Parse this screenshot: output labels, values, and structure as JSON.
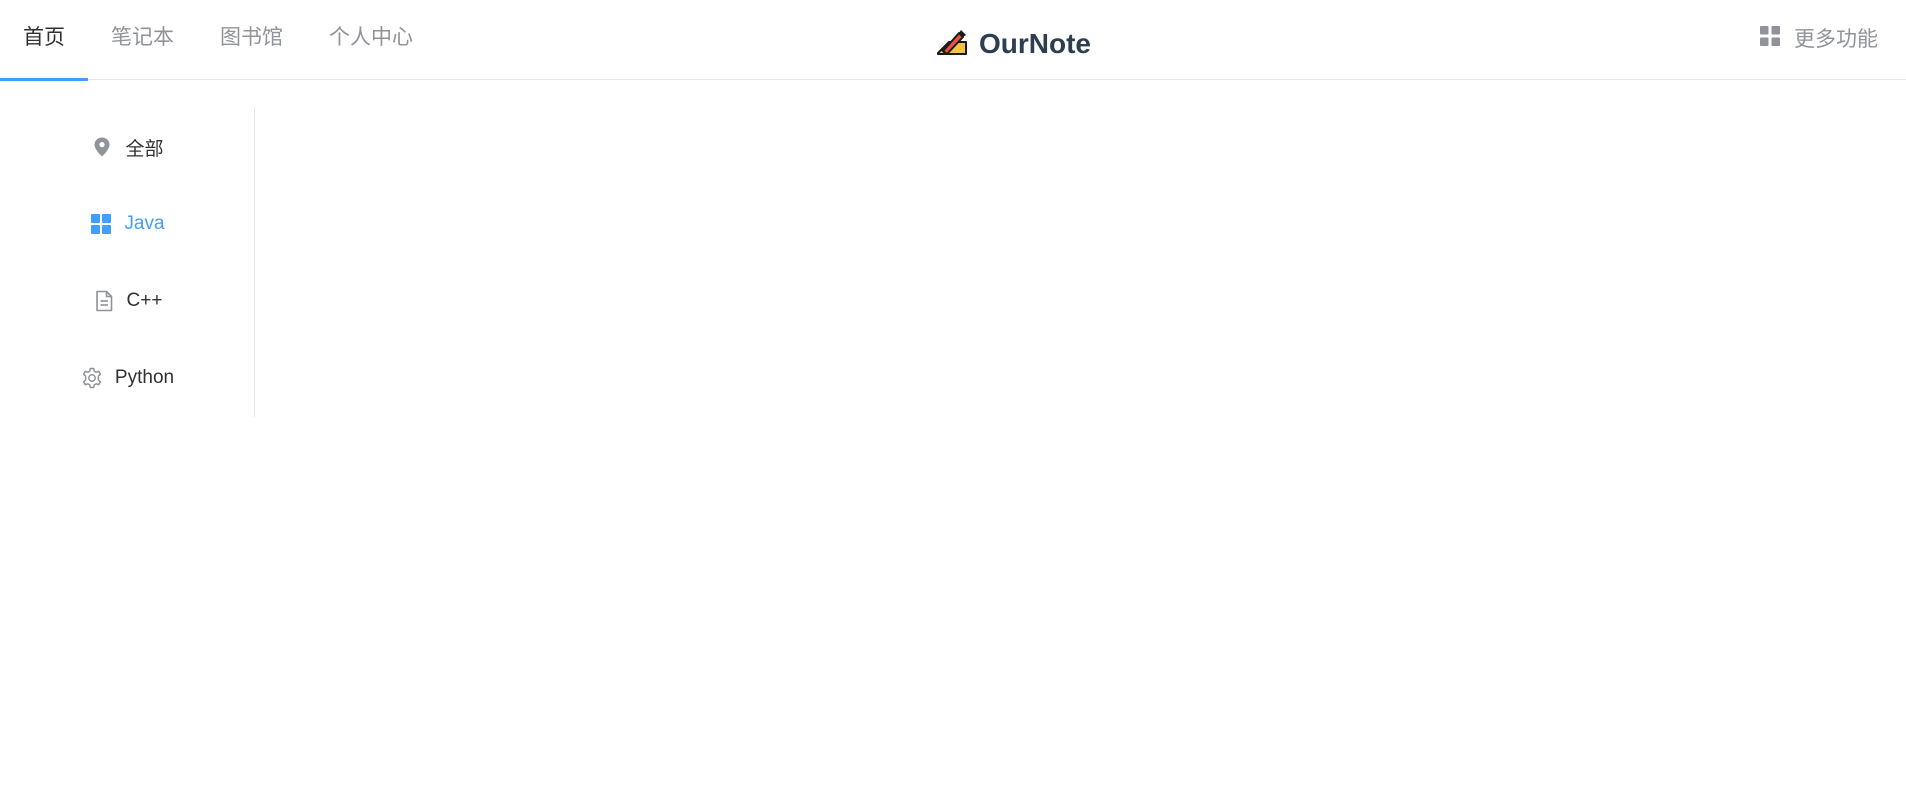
{
  "header": {
    "tabs": [
      {
        "label": "首页",
        "active": true
      },
      {
        "label": "笔记本",
        "active": false
      },
      {
        "label": "图书馆",
        "active": false
      },
      {
        "label": "个人中心",
        "active": false
      }
    ],
    "logo": {
      "title": "OurNote",
      "icon": "pencil-note-icon"
    },
    "more": {
      "label": "更多功能",
      "icon": "grid-icon"
    }
  },
  "sidebar": {
    "items": [
      {
        "label": "全部",
        "icon": "location-pin-icon",
        "active": false
      },
      {
        "label": "Java",
        "icon": "grid-icon",
        "active": true
      },
      {
        "label": "C++",
        "icon": "document-icon",
        "active": false
      },
      {
        "label": "Python",
        "icon": "gear-icon",
        "active": false
      }
    ]
  },
  "colors": {
    "accent": "#409eff",
    "tab_inactive": "#909399",
    "text": "#303133",
    "logo_text": "#2c3e50",
    "divider": "#e4e7ed"
  }
}
